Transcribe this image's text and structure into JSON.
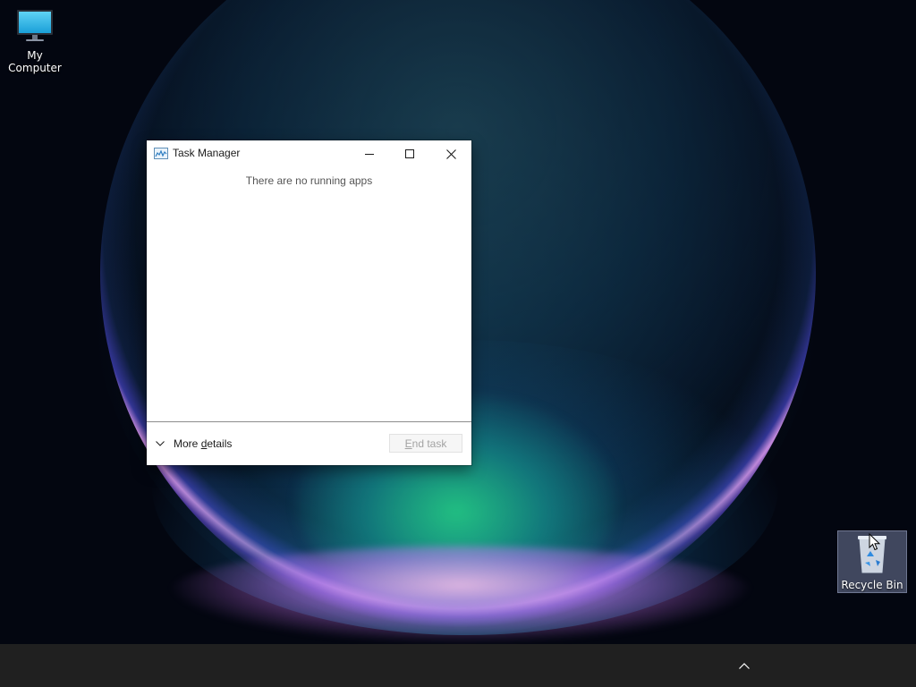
{
  "desktop": {
    "icons": [
      {
        "label": "My Computer",
        "icon": "monitor-icon"
      },
      {
        "label": "Recycle Bin",
        "icon": "recycle-bin-icon",
        "selected": true
      }
    ]
  },
  "window": {
    "title": "Task Manager",
    "app_icon": "task-manager-icon",
    "empty_message": "There are no running apps",
    "more_details_prefix": "More ",
    "more_details_underlined": "d",
    "more_details_suffix": "etails",
    "end_task_underlined": "E",
    "end_task_suffix": "nd task",
    "end_task_enabled": false,
    "caption_buttons": [
      "minimize-icon",
      "maximize-icon",
      "close-icon"
    ]
  },
  "taskbar": {
    "tray_icon": "chevron-up-icon",
    "background": "#202020"
  },
  "colors": {
    "window_bg": "#ffffff",
    "disabled_text": "#a3a3a3",
    "desktop_bg": "#030610"
  }
}
